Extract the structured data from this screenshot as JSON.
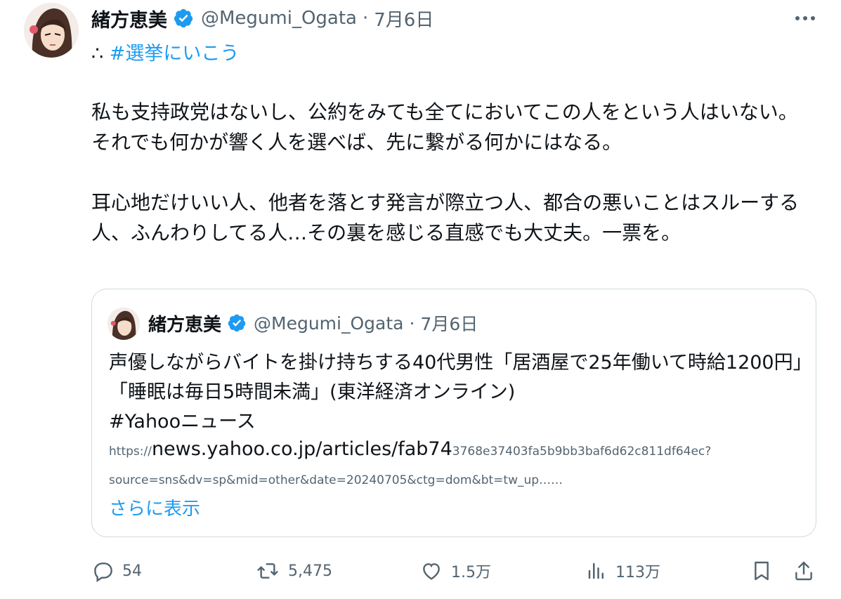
{
  "tweet": {
    "author_name": "緒方恵美",
    "handle": "@Megumi_Ogata",
    "date": "7月6日",
    "prefix": "∴",
    "hashtag": "#選挙にいこう",
    "paragraph1": "私も支持政党はないし、公約をみても全てにおいてこの人をという人はいない。",
    "paragraph2": "それでも何かが響く人を選べば、先に繋がる何かにはなる。",
    "paragraph3": "耳心地だけいい人、他者を落とす発言が際立つ人、都合の悪いことはスルーする人、ふんわりしてる人…その裏を感じる直感でも大丈夫。一票を。"
  },
  "quoted": {
    "author_name": "緒方恵美",
    "handle": "@Megumi_Ogata",
    "date": "7月6日",
    "text_line": "声優しながらバイトを掛け持ちする40代男性「居酒屋で25年働いて時給1200円」「睡眠は毎日5時間未満」(東洋経済オンライン)",
    "hashtag": "#Yahooニュース",
    "link_scheme": "https://",
    "link_host": "news.yahoo.co.jp/articles/fab74",
    "link_rest": "3768e37403fa5b9bb3baf6d62c811df64ec?",
    "link_line2": "source=sns&dv=sp&mid=other&date=20240705&ctg=dom&bt=tw_up……",
    "show_more": "さらに表示"
  },
  "actions": {
    "replies": "54",
    "retweets": "5,475",
    "likes": "1.5万",
    "views": "113万"
  },
  "icons": [
    "verified-badge-icon",
    "more-icon",
    "reply-icon",
    "retweet-icon",
    "like-icon",
    "views-icon",
    "bookmark-icon",
    "share-icon"
  ],
  "colors": {
    "accent": "#1d9bf0",
    "muted": "#536471",
    "border": "#cfd9de"
  }
}
